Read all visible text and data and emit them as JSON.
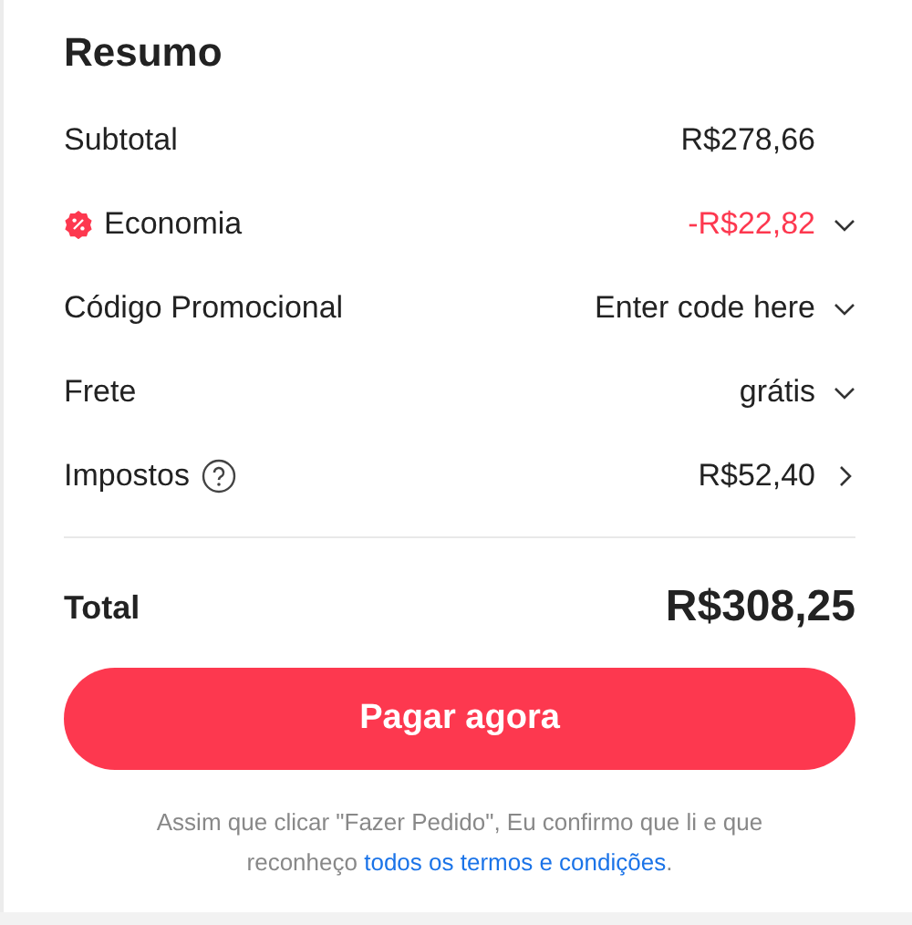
{
  "title": "Resumo",
  "rows": [
    {
      "label": "Subtotal",
      "value": "R$278,66",
      "kind": "plain"
    },
    {
      "label": "Economia",
      "value": "-R$22,82",
      "kind": "discount"
    },
    {
      "label": "Código Promocional",
      "value": "Enter code here",
      "kind": "dropdown"
    },
    {
      "label": "Frete",
      "value": "grátis",
      "kind": "dropdown"
    },
    {
      "label": "Impostos",
      "value": "R$52,40",
      "kind": "help"
    }
  ],
  "total": {
    "label": "Total",
    "value": "R$308,25"
  },
  "button": "Pagar agora",
  "footer": {
    "text": "Assim que clicar \"Fazer Pedido\", Eu confirmo que li e que reconheço",
    "link": "todos os termos e condições",
    "end": "."
  }
}
